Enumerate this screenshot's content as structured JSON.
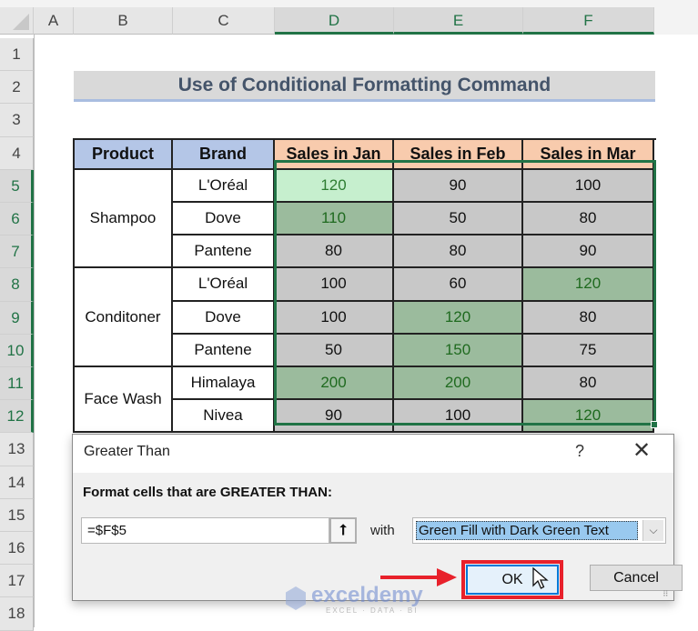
{
  "spreadsheet": {
    "columns": [
      "A",
      "B",
      "C",
      "D",
      "E",
      "F"
    ],
    "selected_columns": [
      "D",
      "E",
      "F"
    ],
    "rows": [
      "1",
      "2",
      "3",
      "4",
      "5",
      "6",
      "7",
      "8",
      "9",
      "10",
      "11",
      "12",
      "13",
      "14",
      "15",
      "16",
      "17",
      "18"
    ],
    "selected_rows": [
      "5",
      "6",
      "7",
      "8",
      "9",
      "10",
      "11",
      "12"
    ],
    "title": "Use of Conditional Formatting Command",
    "table": {
      "headers": [
        "Product",
        "Brand",
        "Sales in Jan",
        "Sales in Feb",
        "Sales in Mar"
      ],
      "groups": [
        {
          "product": "Shampoo",
          "brands": [
            {
              "brand": "L'Oréal",
              "jan": "120",
              "feb": "90",
              "mar": "100"
            },
            {
              "brand": "Dove",
              "jan": "110",
              "feb": "50",
              "mar": "80"
            },
            {
              "brand": "Pantene",
              "jan": "80",
              "feb": "80",
              "mar": "90"
            }
          ]
        },
        {
          "product": "Conditoner",
          "brands": [
            {
              "brand": "L'Oréal",
              "jan": "100",
              "feb": "60",
              "mar": "120"
            },
            {
              "brand": "Dove",
              "jan": "100",
              "feb": "120",
              "mar": "80"
            },
            {
              "brand": "Pantene",
              "jan": "50",
              "feb": "150",
              "mar": "75"
            }
          ]
        },
        {
          "product": "Face Wash",
          "brands": [
            {
              "brand": "Himalaya",
              "jan": "200",
              "feb": "200",
              "mar": "80"
            },
            {
              "brand": "Nivea",
              "jan": "90",
              "feb": "100",
              "mar": "120"
            }
          ]
        }
      ],
      "highlight_colors": {
        "green_fill": "#9bbb9d",
        "dark_green_text": "#1f6a1f",
        "light_green_fill": "#c6efce",
        "gray_fill": "#c8c8c8"
      }
    }
  },
  "dialog": {
    "title": "Greater Than",
    "help_label": "?",
    "close_label": "✕",
    "prompt": "Format cells that are GREATER THAN:",
    "value": "=$F$5",
    "collapse_icon": "⭡",
    "with_label": "with",
    "format_selected": "Green Fill with Dark Green Text",
    "dropdown_icon": "⌵",
    "ok_label": "OK",
    "cancel_label": "Cancel"
  },
  "watermark": {
    "brand": "exceldemy",
    "tagline": "EXCEL · DATA · BI"
  }
}
